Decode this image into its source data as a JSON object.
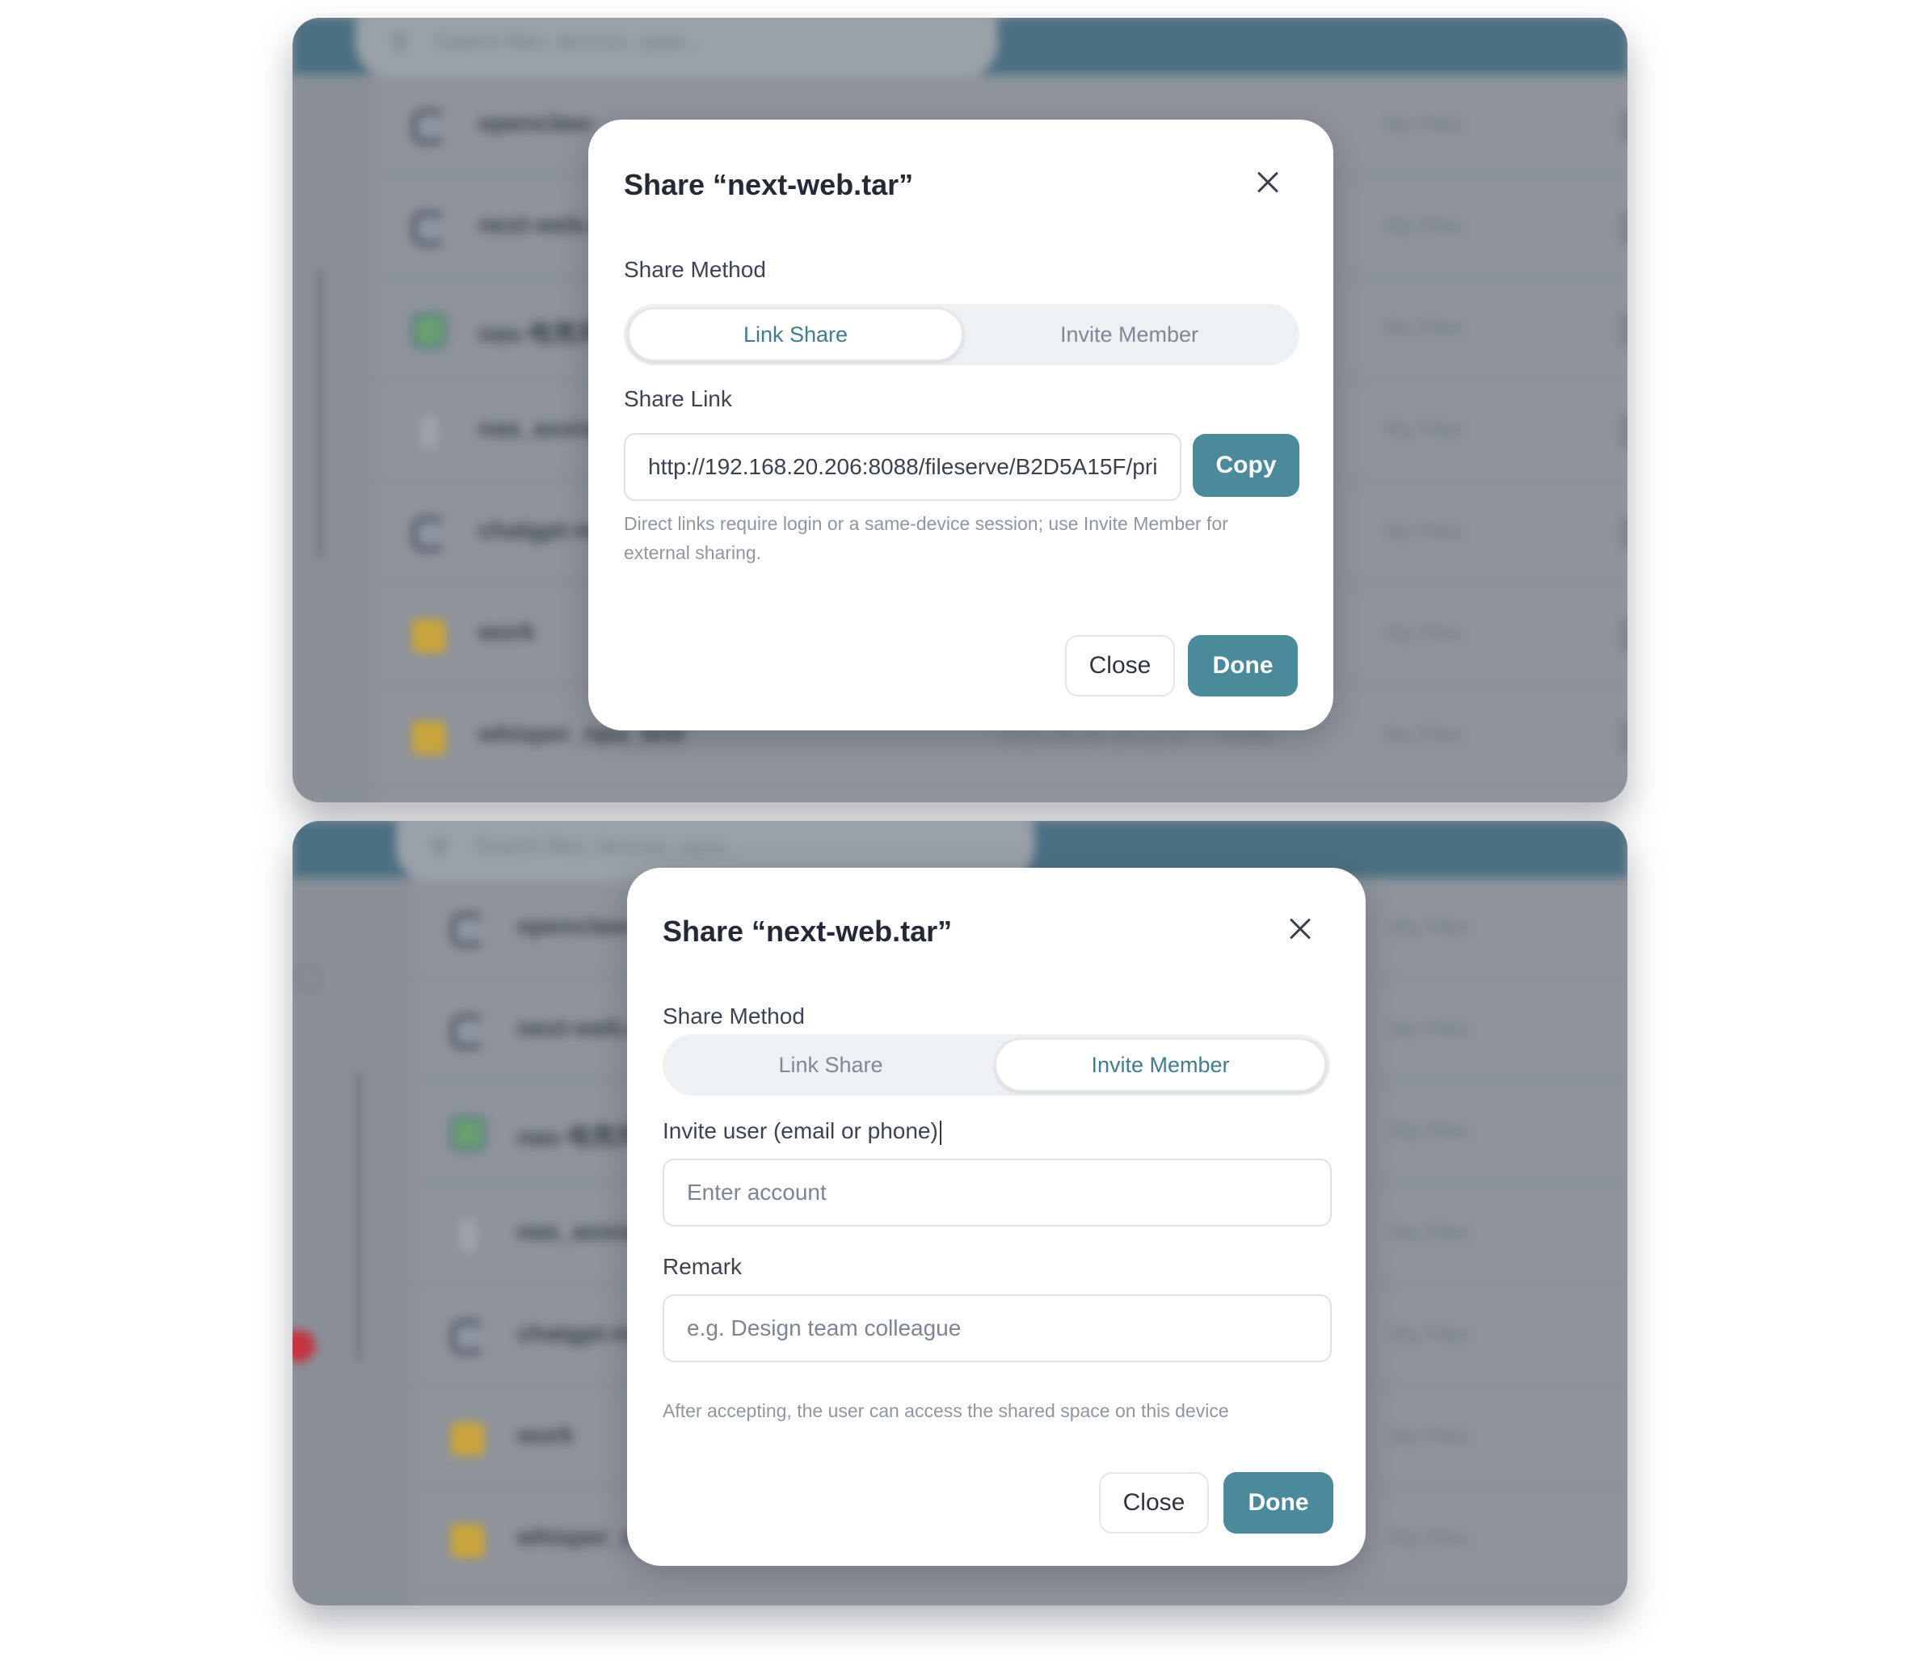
{
  "background_app": {
    "search_placeholder": "Search files, devices, apps...",
    "rows": [
      {
        "name": "openclaw-",
        "icon": "app-icon",
        "date": "",
        "type": "",
        "location": "My Files"
      },
      {
        "name": "next-web.t",
        "icon": "app-icon",
        "date": "",
        "type": "",
        "location": "My Files"
      },
      {
        "name": "nas-电竞风",
        "icon": "image-icon",
        "date": "",
        "type": "",
        "location": "My Files"
      },
      {
        "name": "nas_assista",
        "icon": "person-icon",
        "date": "",
        "type": "",
        "location": "My Files"
      },
      {
        "name": "chatgpt-ne",
        "icon": "app-icon",
        "date": "",
        "type": "",
        "location": "My Files"
      },
      {
        "name": "work",
        "icon": "folder-icon",
        "date": "",
        "type": "",
        "location": "My Files"
      },
      {
        "name": "whisper_npu_test",
        "icon": "folder-icon",
        "date": "2026-06-04 15:12:17",
        "type": "Folder",
        "location": "My Files"
      }
    ]
  },
  "dialog_link": {
    "title": "Share “next-web.tar”",
    "share_method_label": "Share Method",
    "tabs": [
      {
        "label": "Link Share",
        "active": true
      },
      {
        "label": "Invite Member",
        "active": false
      }
    ],
    "share_link_label": "Share Link",
    "share_link_value": "http://192.168.20.206:8088/fileserve/B2D5A15F/pri",
    "copy_label": "Copy",
    "hint": "Direct links require login or a same-device session; use Invite Member for external sharing.",
    "close_label": "Close",
    "done_label": "Done"
  },
  "dialog_invite": {
    "title": "Share “next-web.tar”",
    "share_method_label": "Share Method",
    "tabs": [
      {
        "label": "Link Share",
        "active": false
      },
      {
        "label": "Invite Member",
        "active": true
      }
    ],
    "invite_label": "Invite user (email or phone)",
    "account_placeholder": "Enter account",
    "remark_label": "Remark",
    "remark_placeholder": "e.g. Design team colleague",
    "hint": "After accepting, the user can access the shared space on this device",
    "close_label": "Close",
    "done_label": "Done"
  },
  "colors": {
    "accent": "#4b8a9b",
    "appbar": "#4b6f82",
    "overlay": "#8e939c"
  }
}
